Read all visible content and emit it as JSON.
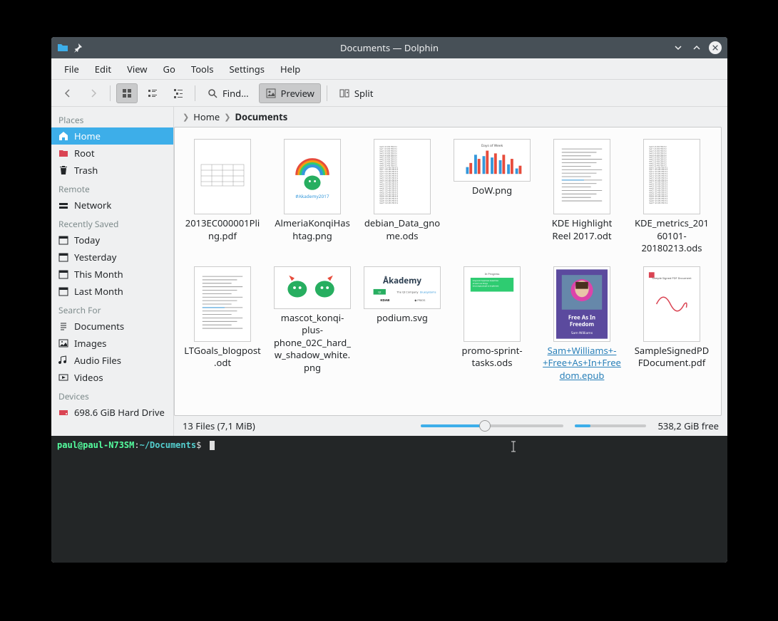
{
  "window": {
    "title": "Documents — Dolphin"
  },
  "menu": [
    "File",
    "Edit",
    "View",
    "Go",
    "Tools",
    "Settings",
    "Help"
  ],
  "toolbar": {
    "find": "Find...",
    "preview": "Preview",
    "split": "Split"
  },
  "sidebar": {
    "sections": [
      {
        "header": "Places",
        "items": [
          {
            "icon": "home",
            "label": "Home",
            "selected": true
          },
          {
            "icon": "root",
            "label": "Root"
          },
          {
            "icon": "trash",
            "label": "Trash"
          }
        ]
      },
      {
        "header": "Remote",
        "items": [
          {
            "icon": "network",
            "label": "Network"
          }
        ]
      },
      {
        "header": "Recently Saved",
        "items": [
          {
            "icon": "cal",
            "label": "Today"
          },
          {
            "icon": "cal",
            "label": "Yesterday"
          },
          {
            "icon": "cal",
            "label": "This Month"
          },
          {
            "icon": "cal",
            "label": "Last Month"
          }
        ]
      },
      {
        "header": "Search For",
        "items": [
          {
            "icon": "doc",
            "label": "Documents"
          },
          {
            "icon": "img",
            "label": "Images"
          },
          {
            "icon": "aud",
            "label": "Audio Files"
          },
          {
            "icon": "vid",
            "label": "Videos"
          }
        ]
      },
      {
        "header": "Devices",
        "items": [
          {
            "icon": "hdd",
            "label": "698.6 GiB Hard Drive"
          }
        ]
      }
    ]
  },
  "breadcrumb": [
    {
      "label": "Home",
      "current": false
    },
    {
      "label": "Documents",
      "current": true
    }
  ],
  "files": [
    {
      "name": "2013EC000001Pling.pdf",
      "thumb": "table"
    },
    {
      "name": "AlmeriaKonqiHashtag.png",
      "thumb": "konqi-rainbow"
    },
    {
      "name": "debian_Data_gnome.ods",
      "thumb": "spreadsheet"
    },
    {
      "name": "DoW.png",
      "thumb": "barchart",
      "wide": true
    },
    {
      "name": "KDE Highlight Reel 2017.odt",
      "thumb": "text"
    },
    {
      "name": "KDE_metrics_20160101-20180213.ods",
      "thumb": "spreadsheet"
    },
    {
      "name": "LTGoals_blogpost.odt",
      "thumb": "text"
    },
    {
      "name": "mascot_konqi-plus-phone_02C_hard_w_shadow_white.png",
      "thumb": "two-konqi",
      "wide": true
    },
    {
      "name": "podium.svg",
      "thumb": "akademy-logos",
      "wide": true
    },
    {
      "name": "promo-sprint-tasks.ods",
      "thumb": "green-box"
    },
    {
      "name": "Sam+Williams+-+Free+As+In+Freedom.epub",
      "thumb": "epub",
      "epub": true
    },
    {
      "name": "SampleSignedPDFDocument.pdf",
      "thumb": "signed"
    }
  ],
  "status": {
    "count": "13 Files (7,1 MiB)",
    "disk": "538,2 GiB free"
  },
  "terminal": {
    "user": "paul@paul-N73SM",
    "sep": ":",
    "path": "~/Documents",
    "prompt": "$"
  }
}
